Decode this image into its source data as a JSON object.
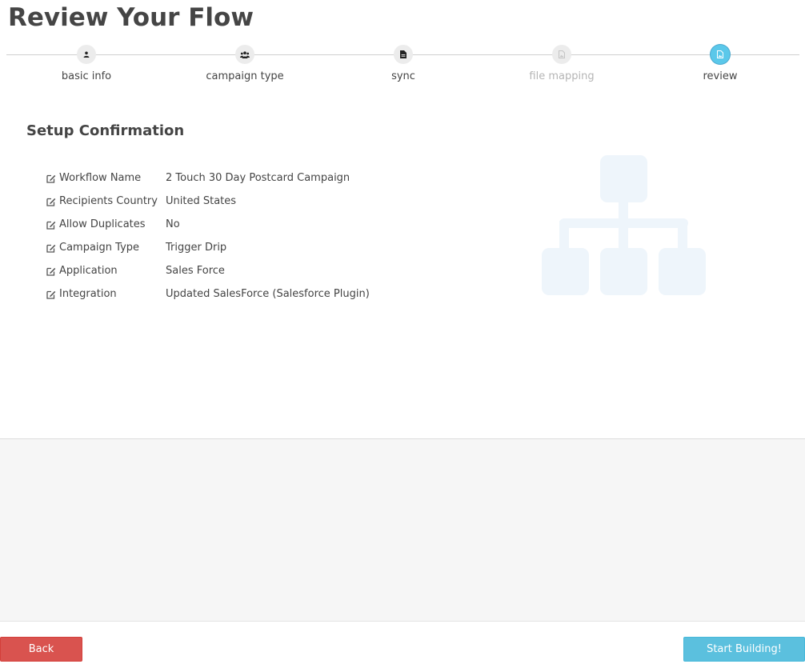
{
  "page": {
    "title": "Review Your Flow"
  },
  "stepper": {
    "steps": [
      {
        "label": "basic info",
        "icon": "user-icon",
        "state": "done"
      },
      {
        "label": "campaign type",
        "icon": "users-icon",
        "state": "done"
      },
      {
        "label": "sync",
        "icon": "file-icon",
        "state": "done"
      },
      {
        "label": "file mapping",
        "icon": "file-image-icon",
        "state": "disabled"
      },
      {
        "label": "review",
        "icon": "file-image-icon",
        "state": "active"
      }
    ]
  },
  "confirmation": {
    "title": "Setup Confirmation",
    "rows": [
      {
        "key": "Workflow Name",
        "value": "2 Touch 30 Day Postcard Campaign"
      },
      {
        "key": "Recipients Country",
        "value": "United States"
      },
      {
        "key": "Allow Duplicates",
        "value": "No"
      },
      {
        "key": "Campaign Type",
        "value": "Trigger Drip"
      },
      {
        "key": "Application",
        "value": "Sales Force"
      },
      {
        "key": "Integration",
        "value": "Updated SalesForce (Salesforce Plugin)"
      }
    ]
  },
  "footer": {
    "back_label": "Back",
    "start_label": "Start Building!"
  },
  "colors": {
    "back": "#d9534f",
    "start": "#5bc0de",
    "active_step": "#5bc8ea",
    "graphic": "#eef5fb"
  }
}
